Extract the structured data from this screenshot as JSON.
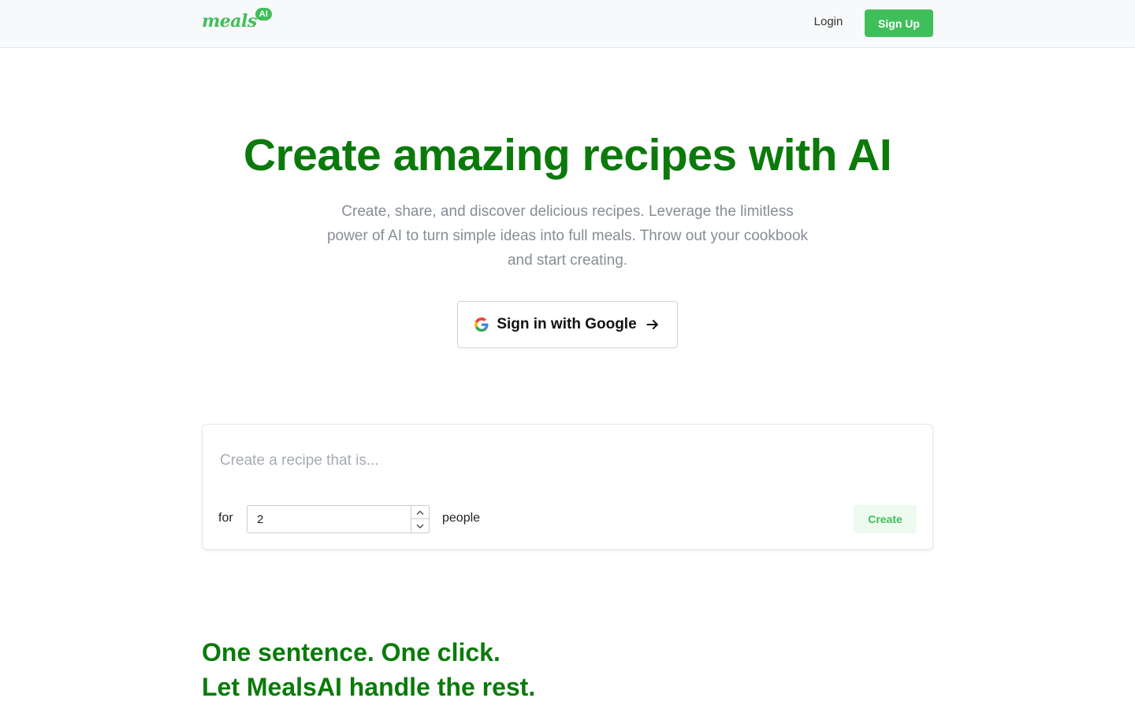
{
  "header": {
    "logo_text": "meals",
    "logo_badge": "AI",
    "login_label": "Login",
    "signup_label": "Sign Up"
  },
  "hero": {
    "title": "Create amazing recipes with AI",
    "subtitle": "Create, share, and discover delicious recipes. Leverage the limitless power of AI to turn simple ideas into full meals. Throw out your cookbook and start creating.",
    "google_button_label": "Sign in with Google"
  },
  "recipe_form": {
    "input_placeholder": "Create a recipe that is...",
    "input_value": "",
    "for_label": "for",
    "servings_value": "2",
    "people_label": "people",
    "create_label": "Create"
  },
  "tagline": {
    "line1": "One sentence. One click.",
    "line2": "Let MealsAI handle the rest."
  },
  "icons": {
    "google": "google-logo-icon",
    "arrow": "arrow-right-icon",
    "stepper_up": "chevron-up-icon",
    "stepper_down": "chevron-down-icon"
  },
  "colors": {
    "brand_green": "#3fbf5a",
    "heading_green": "#0b7a0b",
    "muted_text": "#878d96"
  }
}
